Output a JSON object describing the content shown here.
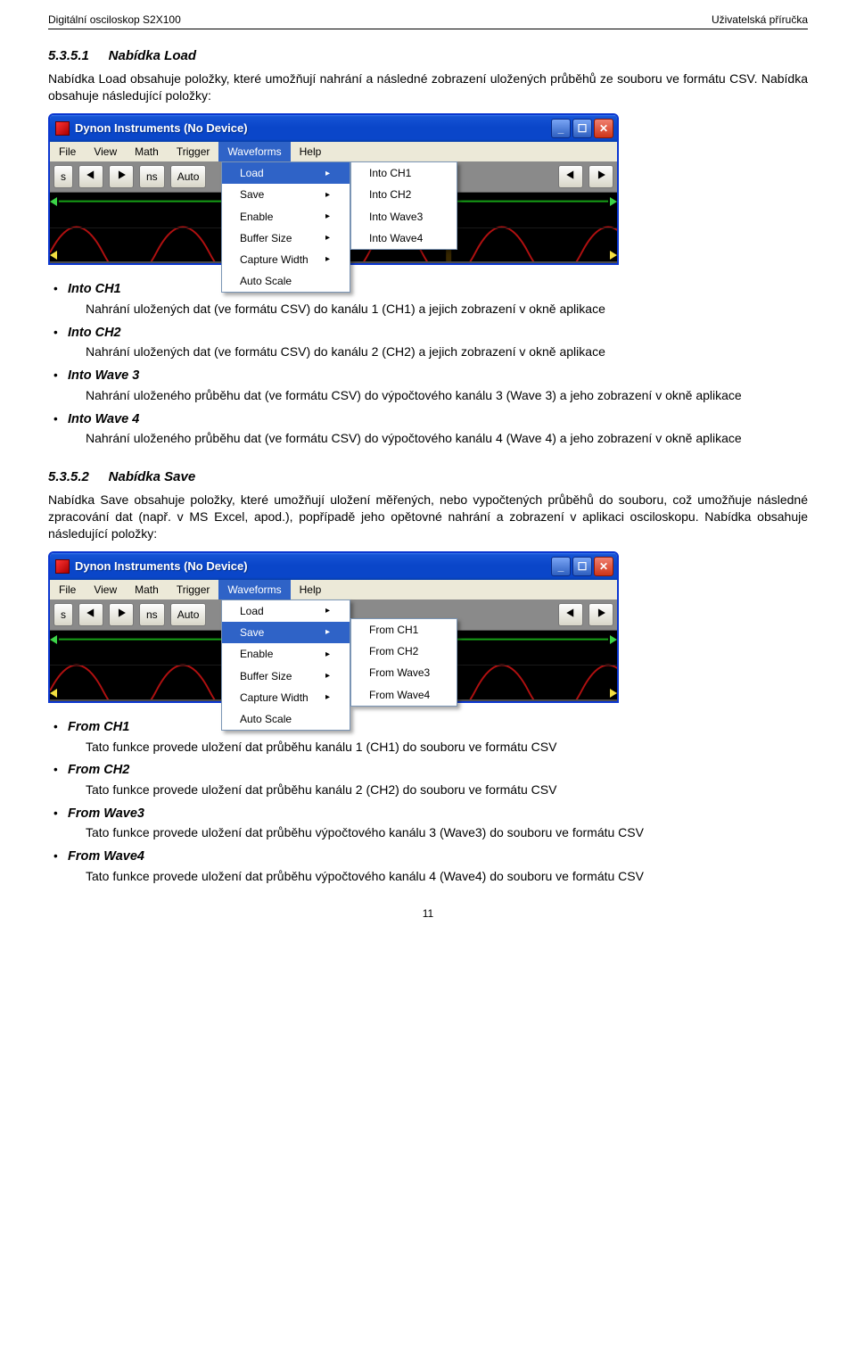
{
  "header": {
    "left": "Digitální osciloskop S2X100",
    "right": "Uživatelská příručka"
  },
  "section1": {
    "num": "5.3.5.1",
    "title": "Nabídka Load",
    "para": "Nabídka Load obsahuje položky, které umožňují nahrání a následné zobrazení uložených průběhů ze souboru ve formátu CSV. Nabídka obsahuje následující položky:"
  },
  "screenshot1": {
    "title": "Dynon Instruments (No Device)",
    "menus": [
      "File",
      "View",
      "Math",
      "Trigger",
      "Waveforms",
      "Help"
    ],
    "tbtns": [
      "s",
      "ns",
      "Auto"
    ],
    "dropdown": [
      "Load",
      "Save",
      "Enable",
      "Buffer Size",
      "Capture Width",
      "Auto Scale"
    ],
    "dropdown_sel_index": 0,
    "submenu": [
      "Into CH1",
      "Into CH2",
      "Into Wave3",
      "Into Wave4"
    ]
  },
  "bullets1": [
    {
      "name": "Into CH1",
      "desc": "Nahrání uložených dat (ve formátu CSV) do kanálu 1 (CH1) a jejich zobrazení v okně aplikace"
    },
    {
      "name": "Into CH2",
      "desc": "Nahrání uložených dat (ve formátu CSV) do kanálu 2 (CH2) a jejich zobrazení v okně aplikace"
    },
    {
      "name": "Into Wave 3",
      "desc": "Nahrání uloženého průběhu dat (ve formátu CSV) do výpočtového kanálu 3 (Wave 3) a jeho zobrazení v okně aplikace"
    },
    {
      "name": "Into Wave 4",
      "desc": "Nahrání uloženého průběhu dat (ve formátu CSV) do výpočtového kanálu 4 (Wave 4) a jeho zobrazení v okně aplikace"
    }
  ],
  "section2": {
    "num": "5.3.5.2",
    "title": "Nabídka Save",
    "para": "Nabídka Save obsahuje položky, které umožňují uložení měřených, nebo vypočtených průběhů do souboru, což umožňuje následné zpracování dat (např. v MS Excel, apod.), popřípadě jeho opětovné nahrání a zobrazení v aplikaci osciloskopu. Nabídka obsahuje následující položky:"
  },
  "screenshot2": {
    "title": "Dynon Instruments (No Device)",
    "menus": [
      "File",
      "View",
      "Math",
      "Trigger",
      "Waveforms",
      "Help"
    ],
    "tbtns": [
      "s",
      "ns",
      "Auto"
    ],
    "dropdown": [
      "Load",
      "Save",
      "Enable",
      "Buffer Size",
      "Capture Width",
      "Auto Scale"
    ],
    "dropdown_sel_index": 1,
    "submenu": [
      "From CH1",
      "From CH2",
      "From Wave3",
      "From Wave4"
    ]
  },
  "bullets2": [
    {
      "name": "From CH1",
      "desc": "Tato funkce provede uložení dat průběhu kanálu 1 (CH1) do souboru ve formátu CSV"
    },
    {
      "name": "From CH2",
      "desc": "Tato funkce provede uložení dat průběhu kanálu 2 (CH2) do souboru ve formátu CSV"
    },
    {
      "name": "From Wave3",
      "desc": "Tato funkce provede uložení dat průběhu výpočtového kanálu 3 (Wave3) do souboru ve formátu CSV"
    },
    {
      "name": "From Wave4",
      "desc": "Tato funkce provede uložení dat průběhu výpočtového kanálu 4 (Wave4) do souboru ve formátu CSV"
    }
  ],
  "pagenum": "11"
}
